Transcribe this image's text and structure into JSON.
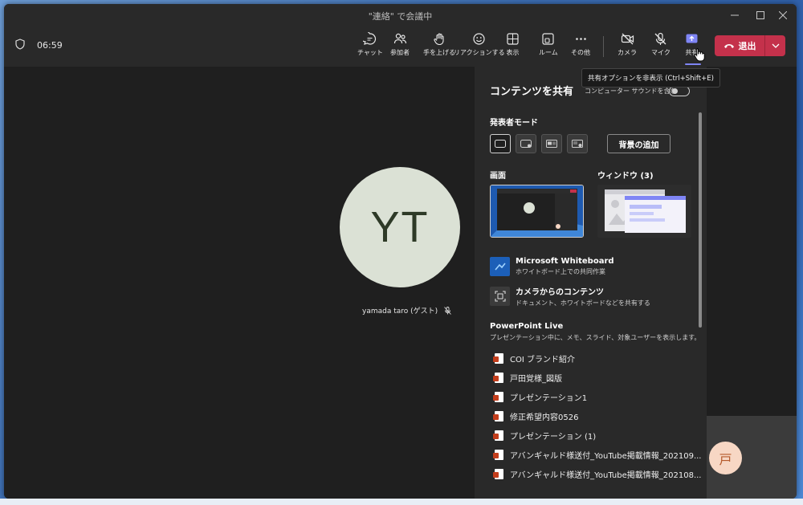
{
  "window": {
    "title": "\"連絡\" で会議中"
  },
  "toolbar": {
    "timer": "06:59",
    "buttons": [
      {
        "label": "チャット",
        "icon": "chat-icon"
      },
      {
        "label": "参加者",
        "icon": "people-icon"
      },
      {
        "label": "手を上げる",
        "icon": "raise-hand-icon"
      },
      {
        "label": "リアクションする",
        "icon": "smile-icon"
      },
      {
        "label": "表示",
        "icon": "grid-view-icon"
      },
      {
        "label": "ルーム",
        "icon": "breakout-room-icon"
      },
      {
        "label": "その他",
        "icon": "more-icon"
      },
      {
        "label": "カメラ",
        "icon": "camera-off-icon"
      },
      {
        "label": "マイク",
        "icon": "mic-off-icon"
      },
      {
        "label": "共有",
        "icon": "share-icon"
      }
    ],
    "leave_label": "退出"
  },
  "tooltip": "共有オプションを非表示 (Ctrl+Shift+E)",
  "participant": {
    "initials": "YT",
    "name": "yamada taro (ゲスト)"
  },
  "panel": {
    "title": "コンテンツを共有",
    "computer_sound_label": "コンピューター サウンドを含む",
    "presenter_mode_label": "発表者モード",
    "add_background_label": "背景の追加",
    "screen_label": "画面",
    "window_label": "ウィンドウ (3)",
    "whiteboard": {
      "title": "Microsoft Whiteboard",
      "subtitle": "ホワイトボード上での共同作業"
    },
    "camera_content": {
      "title": "カメラからのコンテンツ",
      "subtitle": "ドキュメント、ホワイトボードなどを共有する"
    },
    "powerpoint": {
      "title": "PowerPoint Live",
      "subtitle": "プレゼンテーション中に、メモ、スライド、対象ユーザーを表示します。",
      "files": [
        "COI ブランド紹介",
        "戸田覚様_図版",
        "プレゼンテーション1",
        "修正希望内容0526",
        "プレゼンテーション (1)",
        "アバンギャルド様送付_YouTube掲載情報_202109...",
        "アバンギャルド様送付_YouTube掲載情報_202108..."
      ]
    }
  },
  "side_participant": {
    "initial": "戸"
  },
  "colors": {
    "leave": "#c4314b",
    "accent": "#7f85f5",
    "panel_bg": "#292929",
    "stage_bg": "#1f1f1f"
  }
}
